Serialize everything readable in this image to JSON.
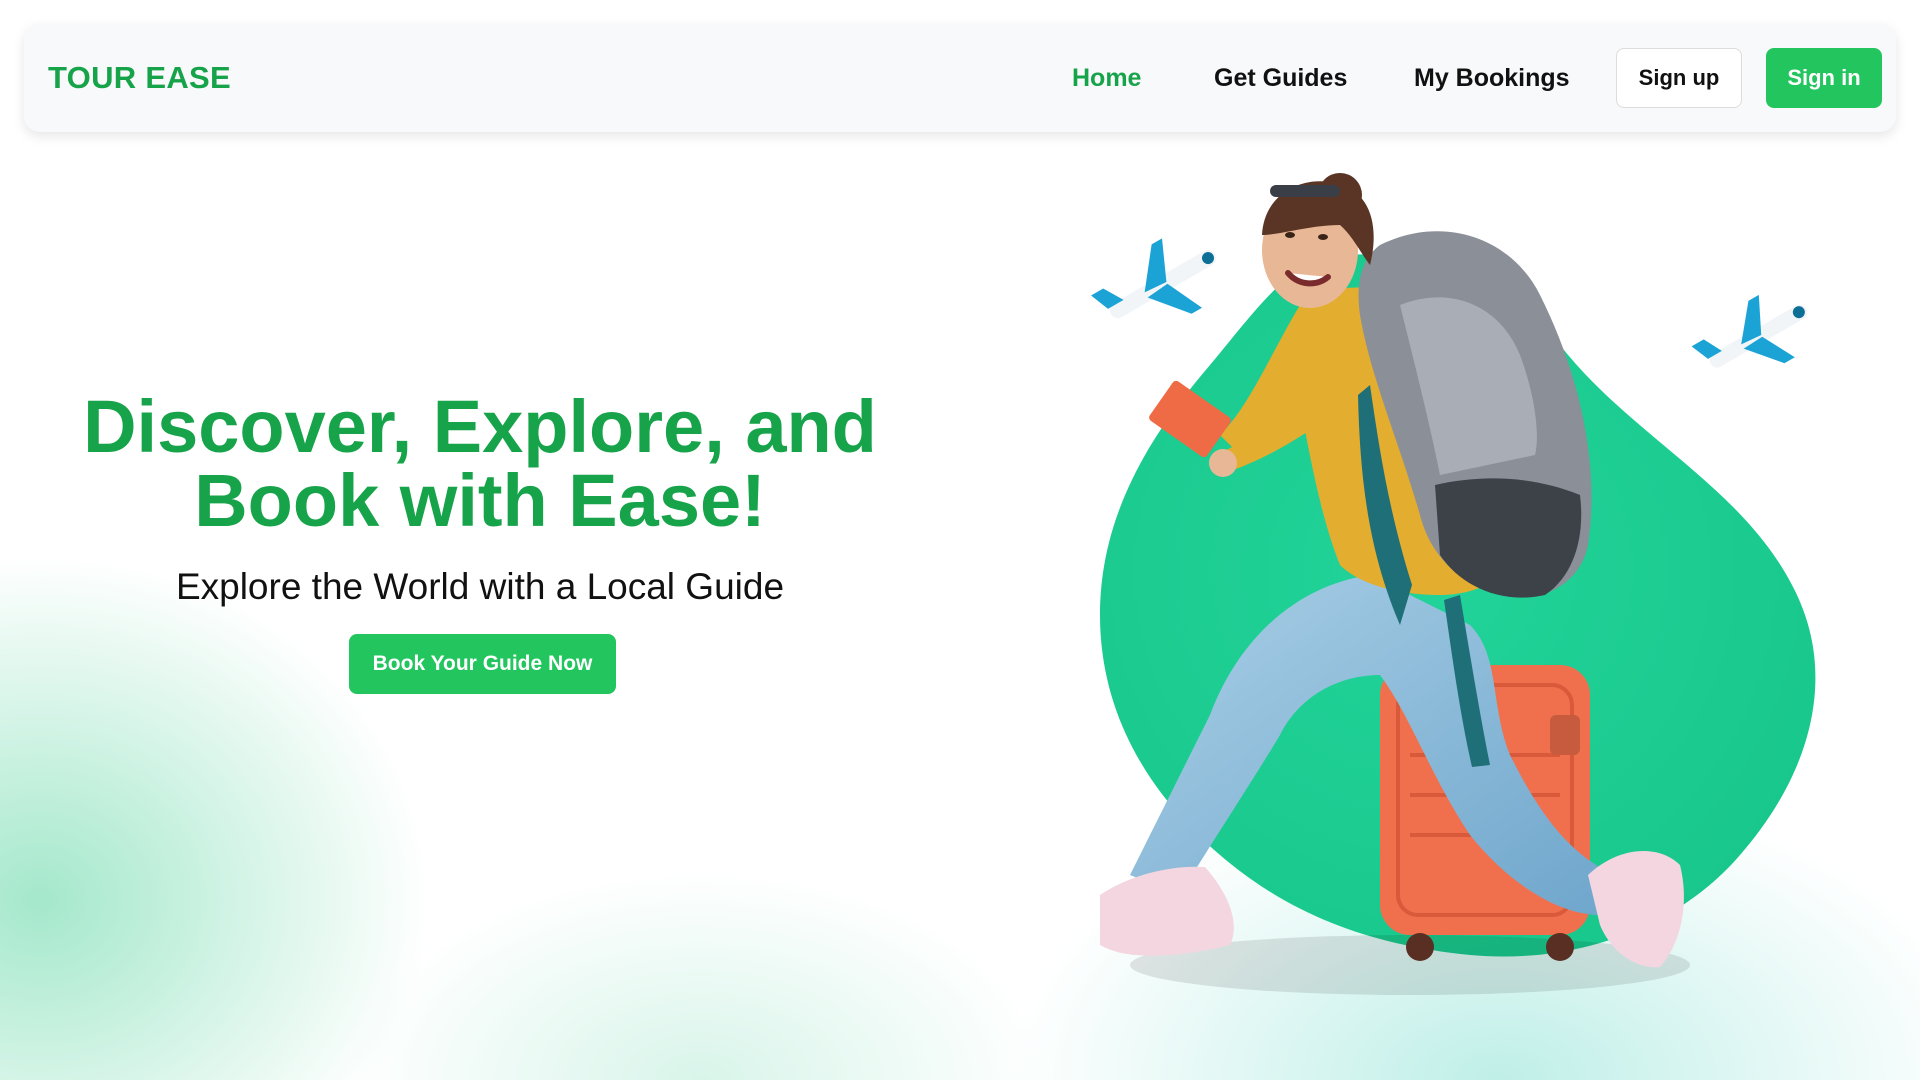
{
  "brand": {
    "name": "TOUR EASE"
  },
  "nav": {
    "links": [
      {
        "label": "Home",
        "active": true
      },
      {
        "label": "Get Guides",
        "active": false
      },
      {
        "label": "My Bookings",
        "active": false
      }
    ],
    "signup_label": "Sign up",
    "signin_label": "Sign in"
  },
  "hero": {
    "title_line1": "Discover, Explore, and",
    "title_line2": "Book with Ease!",
    "subtitle": "Explore the World with a Local Guide",
    "cta_label": "Book Your Guide Now"
  },
  "colors": {
    "brand_green": "#16a34a",
    "button_green": "#22c55e",
    "blob_green": "#1ecf8f"
  },
  "illustration": {
    "icons": [
      "airplane-icon",
      "airplane-icon"
    ],
    "subject": "traveler-with-backpack-on-suitcase"
  }
}
